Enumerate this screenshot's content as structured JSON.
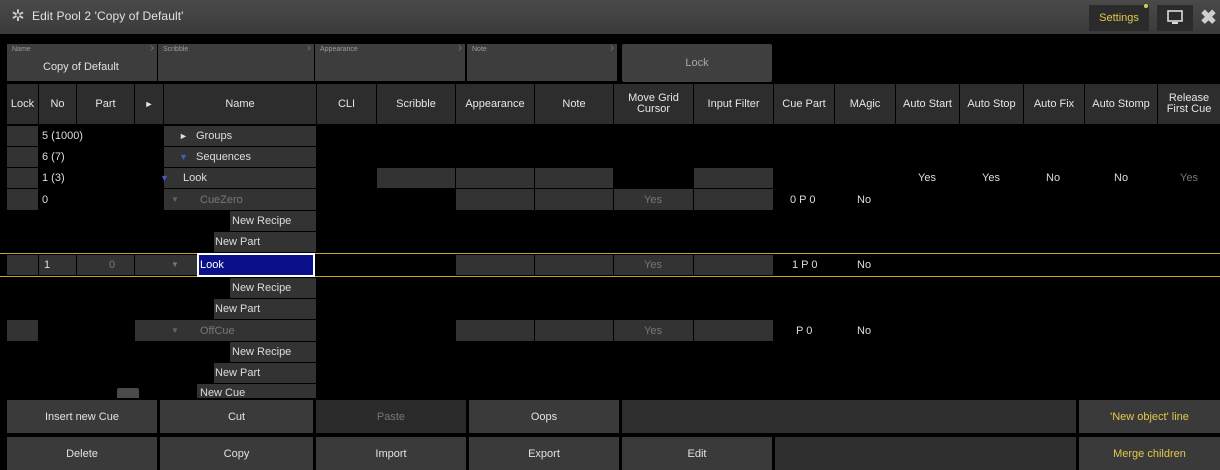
{
  "window": {
    "title": "Edit Pool 2 'Copy of Default'",
    "settings_label": "Settings"
  },
  "fields": {
    "name_label": "Name",
    "name_value": "Copy of Default",
    "scribble_label": "Scribble",
    "appearance_label": "Appearance",
    "note_label": "Note",
    "lock_label": "Lock"
  },
  "columns": {
    "lock": "Lock",
    "no": "No",
    "part": "Part",
    "expand": "►",
    "name": "Name",
    "cli": "CLI",
    "scribble": "Scribble",
    "appearance": "Appearance",
    "note": "Note",
    "move_grid_cursor": "Move Grid Cursor",
    "input_filter": "Input Filter",
    "cue_part": "Cue Part",
    "magic": "MAgic",
    "auto_start": "Auto Start",
    "auto_stop": "Auto Stop",
    "auto_fix": "Auto Fix",
    "auto_stomp": "Auto Stomp",
    "release_first_cue": "Release First Cue"
  },
  "tree": {
    "groups": {
      "no": "5 (1000)",
      "expand": "►",
      "name": "Groups"
    },
    "sequences": {
      "no": "6 (7)",
      "expand": "▼",
      "name": "Sequences"
    },
    "look_seq": {
      "no": "1 (3)",
      "expand": "▼",
      "name": "Look",
      "auto_start": "Yes",
      "auto_stop": "Yes",
      "auto_fix": "No",
      "auto_stomp": "No",
      "release_first_cue": "Yes"
    },
    "cuezero": {
      "no": "0",
      "expand": "▼",
      "name": "CueZero",
      "move_grid": "Yes",
      "cue_part": "0 P 0",
      "magic": "No"
    },
    "cuezero_recipe": "New Recipe",
    "cuezero_part": "New Part",
    "cue1": {
      "no": "1",
      "part": "0",
      "expand": "▼",
      "name": "Look",
      "move_grid": "Yes",
      "cue_part": "1 P 0",
      "magic": "No"
    },
    "cue1_recipe": "New Recipe",
    "cue1_part": "New Part",
    "offcue": {
      "expand": "▼",
      "name": "OffCue",
      "move_grid": "Yes",
      "cue_part": "P 0",
      "magic": "No"
    },
    "offcue_recipe": "New Recipe",
    "offcue_part": "New Part",
    "new_cue": "New Cue"
  },
  "buttons": {
    "insert_new_cue": "Insert new Cue",
    "cut": "Cut",
    "paste": "Paste",
    "oops": "Oops",
    "new_object_line": "'New object' line",
    "delete": "Delete",
    "copy": "Copy",
    "import": "Import",
    "export": "Export",
    "edit": "Edit",
    "merge_children": "Merge children"
  },
  "colors": {
    "accent_yellow": "#e2c94a",
    "selection_blue": "#0a0f8a",
    "tree_arrow": "#4b56c8"
  }
}
